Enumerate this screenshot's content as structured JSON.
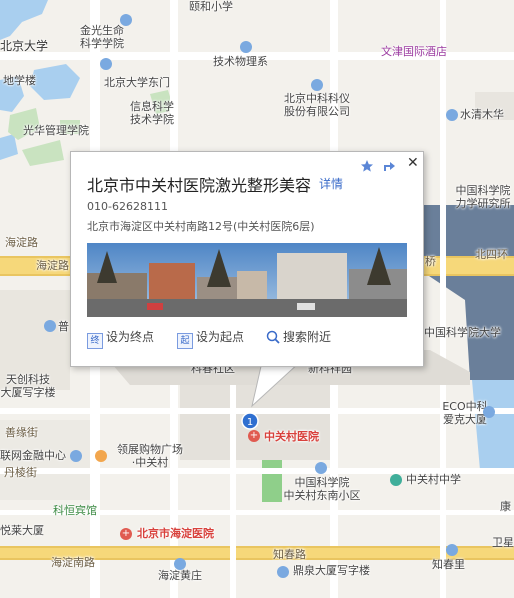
{
  "popup": {
    "title": "北京市中关村医院激光整形美容",
    "detail_link": "详情",
    "phone": "010-62628111",
    "address": "北京市海淀区中关村南路12号(中关村医院6层)",
    "actions": [
      {
        "icon": "终",
        "label": "设为终点"
      },
      {
        "icon": "起",
        "label": "设为起点"
      },
      {
        "icon": "search-icon",
        "label": "搜索附近"
      }
    ],
    "close_symbol": "✕"
  },
  "pin": {
    "number": "1"
  },
  "labels": {
    "yiheyuan": "颐和小学",
    "pku": "北京大学",
    "jinguang": "金光生命\n科学学院",
    "dixue": "地学楼",
    "pku_east": "北京大学东门",
    "jishu": "技术物理系",
    "wenjin": "文津国际酒店",
    "xinxi": "信息科学\n技术学院",
    "zhongke_yi": "北京中科科仪\n股份有限公司",
    "guanghua": "光华管理学院",
    "shuiqing": "水清木华",
    "lixue": "中国科学院\n力学研究所",
    "haidian_rd": "海淀路",
    "haidian_rd2": "海淀路",
    "qiao": "桥",
    "beisihuan": "北四环",
    "pu": "普",
    "ucas": "中国科学院大学",
    "kejiao": "科春社区",
    "xinke": "新科祥园",
    "tiankeji": "天创科技\n大厦写字楼",
    "shanjie": "善缘街",
    "ecozhong": "ECO中科\n爱克大厦",
    "zgc_hosp": "中关村医院",
    "lianwang": "联网金融中心",
    "lingzhan": "领展购物广场\n·中关村",
    "danleng": "丹棱街",
    "zhongke_dong": "中国科学院\n中关村东南小区",
    "zgc_middle": "中关村中学",
    "kehengbin": "科恒宾馆",
    "yuelai": "悦莱大厦",
    "haidian_hosp": "北京市海淀医院",
    "kang": "康",
    "haidian_nan": "海淀南路",
    "zhichun": "知春路",
    "haidianhuang": "海淀黄庄",
    "dingquan": "鼎泉大厦写字楼",
    "zhichunli": "知春里",
    "weier": "卫星"
  }
}
